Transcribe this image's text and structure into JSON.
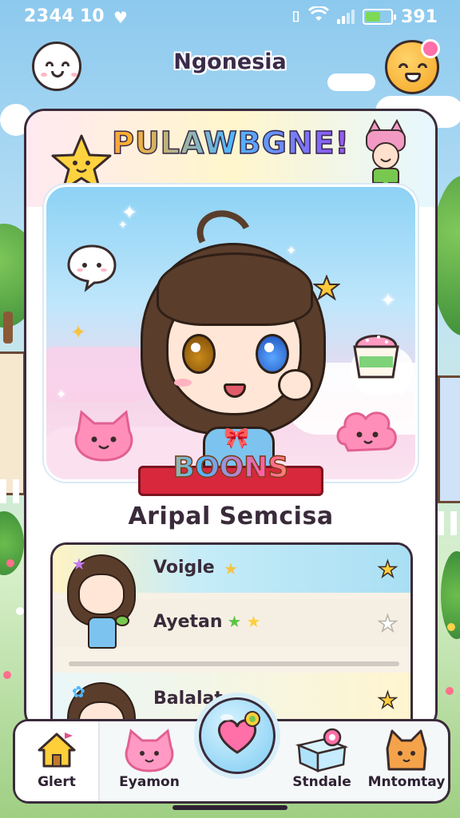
{
  "status_bar": {
    "time": "2344",
    "notification_count": "10",
    "battery_value": "391",
    "battery_level": 0.6
  },
  "header": {
    "title": "Ngonesia"
  },
  "card": {
    "banner_title": "PULAWBGNE!",
    "ribbon_text": "BOONS",
    "character_name": "Aripal Semcisa"
  },
  "list": {
    "rows": [
      {
        "label": "Voigle",
        "favorite": true
      },
      {
        "label": "Ayetan",
        "favorite": false
      },
      {
        "label": "Balalat",
        "favorite": true
      }
    ],
    "progress": 0.0
  },
  "nav": {
    "items": [
      {
        "label": "Glert",
        "icon": "house-icon"
      },
      {
        "label": "Eyamon",
        "icon": "pink-cat-icon"
      },
      {
        "label": "Stndale",
        "icon": "gift-box-icon"
      },
      {
        "label": "Mntomtay",
        "icon": "orange-cat-icon"
      }
    ],
    "center_icon": "heart-bubble-icon"
  },
  "colors": {
    "accent_pink": "#ff5fa8",
    "accent_blue": "#7cc4ef",
    "ribbon_red": "#d8283b",
    "star_gold": "#f6c343"
  }
}
